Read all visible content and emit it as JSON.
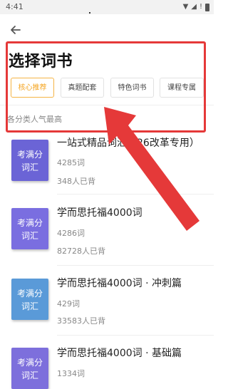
{
  "status": {
    "time": "4:41",
    "indicator": "!"
  },
  "header": {
    "back_icon": "back-arrow-icon",
    "title": "选择词书",
    "subtitle": "各分类人气最高"
  },
  "tabs": [
    {
      "label": "核心推荐",
      "active": true
    },
    {
      "label": "真题配套",
      "active": false
    },
    {
      "label": "特色词书",
      "active": false
    },
    {
      "label": "课程专属",
      "active": false
    }
  ],
  "books": [
    {
      "cover_line1": "考满分",
      "cover_line2": "词汇",
      "cover_color": "#6b64d6",
      "title": "一站式精品词汇（26改革专用）",
      "words": "4285词",
      "users": "348人已背"
    },
    {
      "cover_line1": "考满分",
      "cover_line2": "词汇",
      "cover_color": "#7a6ee0",
      "title": "学而思托福4000词",
      "words": "4286词",
      "users": "82728人已背"
    },
    {
      "cover_line1": "考满分",
      "cover_line2": "词汇",
      "cover_color": "#5a9ad8",
      "title": "学而思托福4000词 · 冲刺篇",
      "words": "429词",
      "users": "33583人已背"
    },
    {
      "cover_line1": "考满分",
      "cover_line2": "词汇",
      "cover_color": "#7d6fdc",
      "title": "学而思托福4000词 · 基础篇",
      "words": "1334词",
      "users": ""
    }
  ],
  "colors": {
    "accent": "#f5a623",
    "highlight": "#e53939"
  }
}
